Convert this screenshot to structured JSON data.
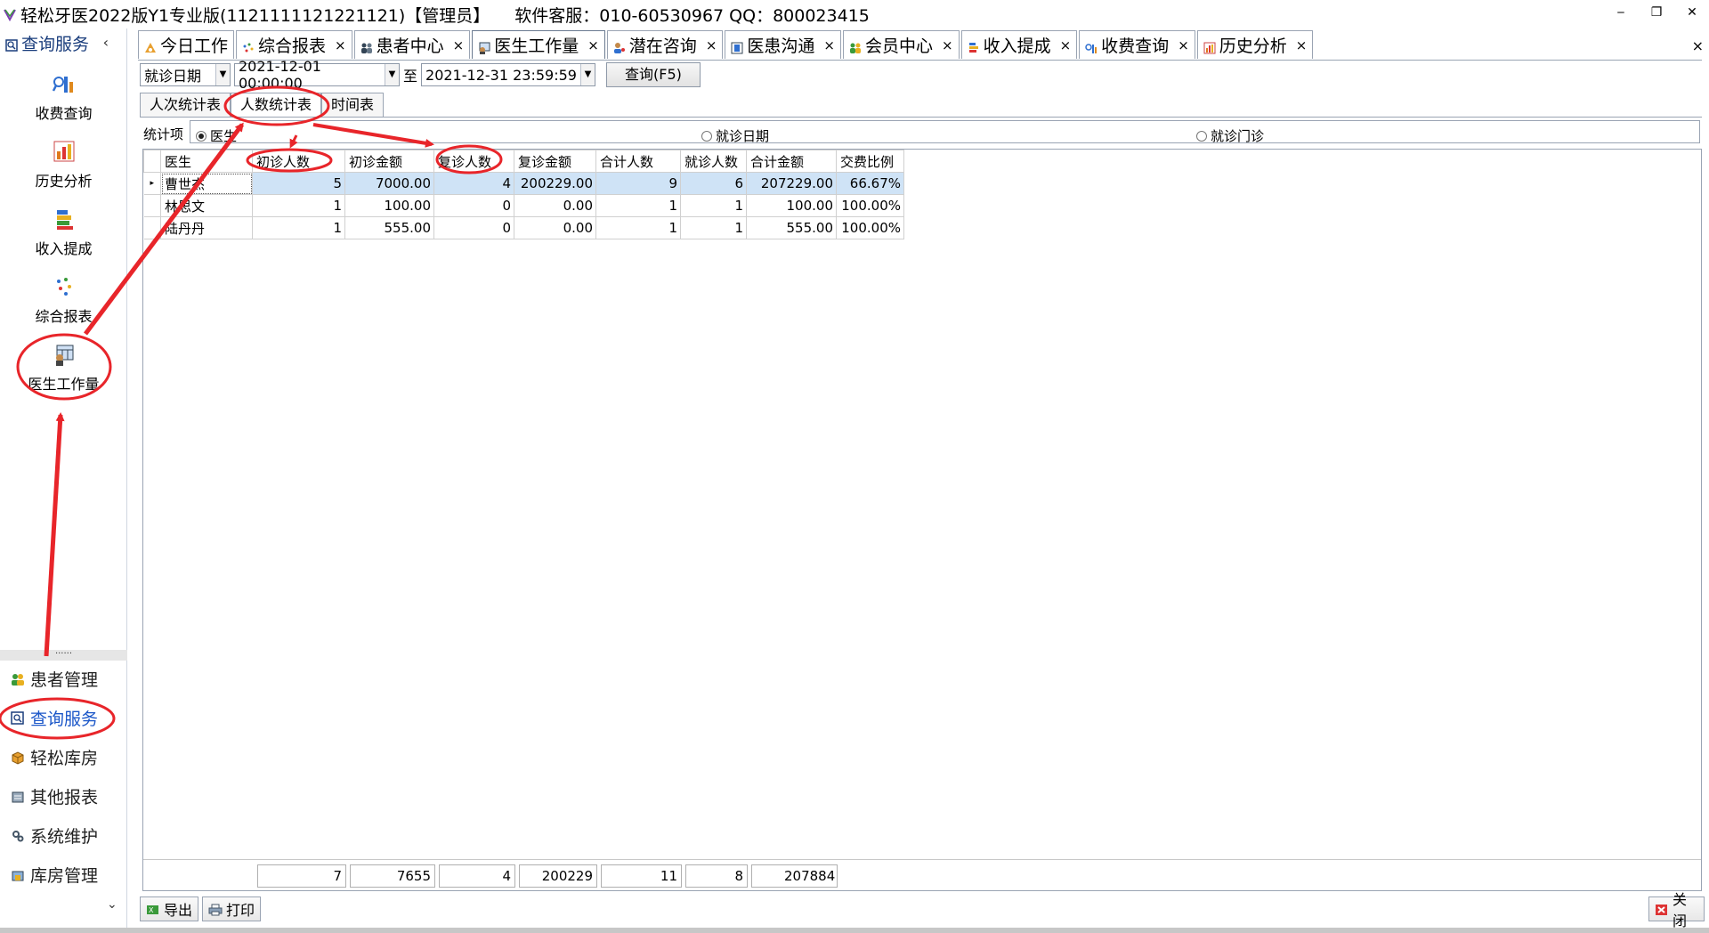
{
  "window": {
    "title": "轻松牙医2022版Y1专业版(1121111121221121)【管理员】",
    "support": "软件客服：010-60530967 QQ：800023415",
    "buttons": [
      "‒",
      "❐",
      "✕"
    ]
  },
  "sidebar": {
    "header": "查询服务",
    "collapse": "‹",
    "items": [
      {
        "label": "收费查询",
        "icon": "chart-magnifier-icon"
      },
      {
        "label": "历史分析",
        "icon": "bar-chart-icon"
      },
      {
        "label": "收入提成",
        "icon": "stacked-bars-icon"
      },
      {
        "label": "综合报表",
        "icon": "scatter-icon"
      },
      {
        "label": "医生工作量",
        "icon": "doctor-calendar-icon"
      }
    ],
    "dots": "......",
    "nav": [
      {
        "label": "患者管理",
        "icon": "people-icon",
        "active": false
      },
      {
        "label": "查询服务",
        "icon": "magnifier-icon",
        "active": true
      },
      {
        "label": "轻松库房",
        "icon": "box-icon",
        "active": false
      },
      {
        "label": "其他报表",
        "icon": "report-icon",
        "active": false
      },
      {
        "label": "系统维护",
        "icon": "gear-icon",
        "active": false
      },
      {
        "label": "库房管理",
        "icon": "warehouse-icon",
        "active": false
      }
    ],
    "chevron": "⌄"
  },
  "tabs": [
    {
      "label": "今日工作",
      "close": false,
      "icon": "work-icon"
    },
    {
      "label": "综合报表",
      "close": true,
      "icon": "scatter-icon"
    },
    {
      "label": "患者中心",
      "close": true,
      "icon": "people-icon"
    },
    {
      "label": "医生工作量",
      "close": true,
      "icon": "doctor-icon",
      "active": true
    },
    {
      "label": "潜在咨询",
      "close": true,
      "icon": "consult-icon"
    },
    {
      "label": "医患沟通",
      "close": true,
      "icon": "phone-icon"
    },
    {
      "label": "会员中心",
      "close": true,
      "icon": "members-icon"
    },
    {
      "label": "收入提成",
      "close": true,
      "icon": "stacked-bars-icon"
    },
    {
      "label": "收费查询",
      "close": true,
      "icon": "chart-magnifier-icon"
    },
    {
      "label": "历史分析",
      "close": true,
      "icon": "bar-chart-icon"
    }
  ],
  "tab_close_symbol": "×",
  "close_all": "×",
  "filter": {
    "date_type": "就诊日期",
    "start": "2021-12-01 00:00:00",
    "to_label": "至",
    "end": "2021-12-31 23:59:59",
    "query_button": "查询(F5)"
  },
  "subtabs": [
    "人次统计表",
    "人数统计表",
    "时间表"
  ],
  "stat": {
    "label": "统计项",
    "options": [
      {
        "label": "医生",
        "checked": true
      },
      {
        "label": "就诊日期",
        "checked": false
      },
      {
        "label": "就诊门诊",
        "checked": false
      }
    ]
  },
  "grid": {
    "columns": [
      "医生",
      "初诊人数",
      "初诊金额",
      "复诊人数",
      "复诊金额",
      "合计人数",
      "就诊人数",
      "合计金额",
      "交费比例"
    ],
    "rows": [
      [
        "曹世杰",
        "5",
        "7000.00",
        "4",
        "200229.00",
        "9",
        "6",
        "207229.00",
        "66.67%"
      ],
      [
        "林思文",
        "1",
        "100.00",
        "0",
        "0.00",
        "1",
        "1",
        "100.00",
        "100.00%"
      ],
      [
        "陆丹丹",
        "1",
        "555.00",
        "0",
        "0.00",
        "1",
        "1",
        "555.00",
        "100.00%"
      ]
    ],
    "row_indicator": "▸",
    "totals": [
      "7",
      "7655",
      "4",
      "200229",
      "11",
      "8",
      "207884"
    ]
  },
  "bottom": {
    "export": "导出",
    "print": "打印",
    "close": "关闭"
  },
  "annotation_color": "#e8252a"
}
